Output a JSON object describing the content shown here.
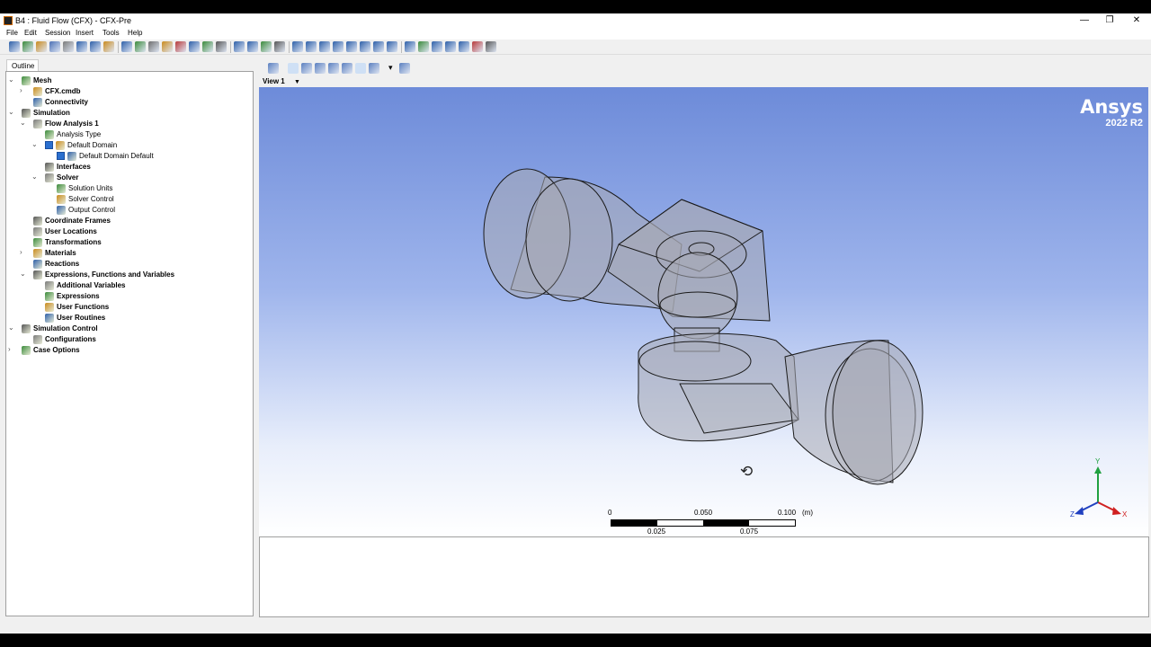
{
  "window": {
    "title": "B4 : Fluid Flow (CFX) - CFX-Pre",
    "controls": {
      "minimize": "—",
      "maximize": "❐",
      "close": "✕"
    }
  },
  "menu": [
    "File",
    "Edit",
    "Session",
    "Insert",
    "Tools",
    "Help"
  ],
  "outline": {
    "tab_label": "Outline",
    "tree": [
      {
        "label": "Mesh",
        "bold": true,
        "level": 0,
        "toggle": "v",
        "icon": "mesh-icon"
      },
      {
        "label": "CFX.cmdb",
        "bold": true,
        "level": 1,
        "toggle": ">",
        "icon": "mesh-file-icon"
      },
      {
        "label": "Connectivity",
        "bold": true,
        "level": 1,
        "toggle": "",
        "icon": "connectivity-icon"
      },
      {
        "label": "Simulation",
        "bold": true,
        "level": 0,
        "toggle": "v",
        "icon": "simulation-icon"
      },
      {
        "label": "Flow Analysis 1",
        "bold": true,
        "level": 1,
        "toggle": "v",
        "icon": "flow-analysis-icon"
      },
      {
        "label": "Analysis Type",
        "bold": false,
        "level": 2,
        "toggle": "",
        "icon": "clock-icon"
      },
      {
        "label": "Default Domain",
        "bold": false,
        "level": 2,
        "toggle": "v",
        "icon": "domain-icon",
        "checked": true
      },
      {
        "label": "Default Domain Default",
        "bold": false,
        "level": 3,
        "toggle": "",
        "icon": "boundary-icon",
        "checked": true
      },
      {
        "label": "Interfaces",
        "bold": true,
        "level": 2,
        "toggle": "",
        "icon": "interfaces-icon"
      },
      {
        "label": "Solver",
        "bold": true,
        "level": 2,
        "toggle": "v",
        "icon": "solver-icon"
      },
      {
        "label": "Solution Units",
        "bold": false,
        "level": 3,
        "toggle": "",
        "icon": "units-icon"
      },
      {
        "label": "Solver Control",
        "bold": false,
        "level": 3,
        "toggle": "",
        "icon": "solver-control-icon"
      },
      {
        "label": "Output Control",
        "bold": false,
        "level": 3,
        "toggle": "",
        "icon": "output-control-icon"
      },
      {
        "label": "Coordinate Frames",
        "bold": true,
        "level": 1,
        "toggle": "",
        "icon": "coordinate-frame-icon"
      },
      {
        "label": "User Locations",
        "bold": true,
        "level": 1,
        "toggle": "",
        "icon": "user-locations-icon"
      },
      {
        "label": "Transformations",
        "bold": true,
        "level": 1,
        "toggle": "",
        "icon": "transformations-icon"
      },
      {
        "label": "Materials",
        "bold": true,
        "level": 1,
        "toggle": ">",
        "icon": "materials-icon"
      },
      {
        "label": "Reactions",
        "bold": true,
        "level": 1,
        "toggle": "",
        "icon": "reactions-icon"
      },
      {
        "label": "Expressions, Functions and Variables",
        "bold": true,
        "level": 1,
        "toggle": "v",
        "icon": "expressions-folder-icon"
      },
      {
        "label": "Additional Variables",
        "bold": true,
        "level": 2,
        "toggle": "",
        "icon": "variables-icon"
      },
      {
        "label": "Expressions",
        "bold": true,
        "level": 2,
        "toggle": "",
        "icon": "expressions-icon"
      },
      {
        "label": "User Functions",
        "bold": true,
        "level": 2,
        "toggle": "",
        "icon": "user-functions-icon"
      },
      {
        "label": "User Routines",
        "bold": true,
        "level": 2,
        "toggle": "",
        "icon": "user-routines-icon"
      },
      {
        "label": "Simulation Control",
        "bold": true,
        "level": 0,
        "toggle": "v",
        "icon": "simulation-control-icon"
      },
      {
        "label": "Configurations",
        "bold": true,
        "level": 1,
        "toggle": "",
        "icon": "configurations-icon"
      },
      {
        "label": "Case Options",
        "bold": true,
        "level": 0,
        "toggle": ">",
        "icon": "case-options-icon"
      }
    ]
  },
  "view": {
    "label": "View 1",
    "dropdown": "▼",
    "brand": "Ansys",
    "version": "2022 R2",
    "scale": {
      "top_labels": [
        "0",
        "0.050",
        "0.100"
      ],
      "unit": "(m)",
      "bottom_labels": [
        "0.025",
        "0.075"
      ]
    },
    "axes": {
      "x": "X",
      "y": "Y",
      "z": "Z"
    }
  },
  "colors": {
    "axis_x": "#d02020",
    "axis_y": "#20a040",
    "axis_z": "#2040c0",
    "geometry_fill": "#a8aab4",
    "geometry_edge": "#1a1a1a"
  }
}
